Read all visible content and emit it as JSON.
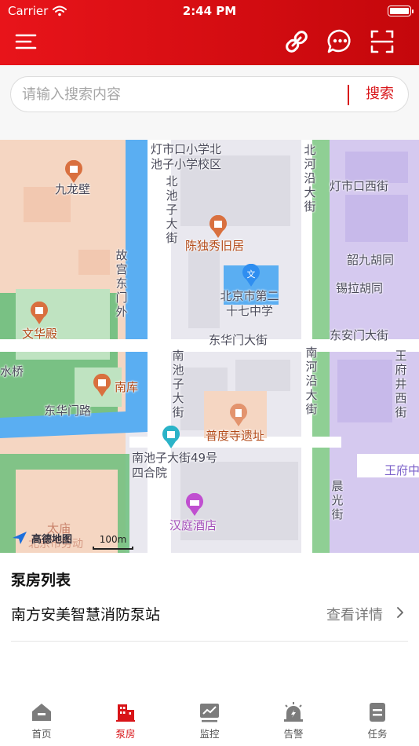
{
  "status_bar": {
    "carrier": "Carrier",
    "time": "2:44 PM"
  },
  "header": {
    "icons": [
      "menu-icon",
      "link-icon",
      "chat-icon",
      "scan-icon"
    ],
    "accent_color": "#d81418"
  },
  "search": {
    "placeholder": "请输入搜索内容",
    "button_label": "搜索"
  },
  "map": {
    "labels": {
      "jiulongbi": "九龙壁",
      "dengshikou_school": "灯市口小学北池子小学校区",
      "beichizi_st": "北池子大街",
      "beiheyan_st": "北河沿大街",
      "dengshikou_w_st": "灯市口西街",
      "chenduxiu": "陈独秀旧居",
      "gugong_dongmenwai": "故宫东门外",
      "shaojiu_hutong": "韶九胡同",
      "xila_hutong": "锡拉胡同",
      "school27": "北京市第二十七中学",
      "wenhuadian": "文华殿",
      "donghuamen_st": "东华门大街",
      "dong_anmen_st": "东安门大街",
      "nanheyan_st": "南河沿大街",
      "wangfujing_w_st": "王府井西街",
      "shuiqiao": "水桥",
      "nanchizi_st": "南池子大街",
      "nanku": "南库",
      "donghuamen_rd": "东华门路",
      "pudusi": "普度寺遗址",
      "siheyuan": "南池子大街49号四合院",
      "wangfu": "王府中",
      "chenguang_st": "晨光街",
      "hanting": "汉庭酒店",
      "taimiao": "太庙",
      "beijing_hint": "北京市劳动",
      "amap_logo": "高德地图",
      "scale": "100m"
    }
  },
  "list": {
    "title": "泵房列表",
    "items": [
      {
        "name": "南方安美智慧消防泵站",
        "action": "查看详情"
      }
    ]
  },
  "tabbar": {
    "active": "泵房",
    "tabs": [
      {
        "label": "首页",
        "icon": "home-icon"
      },
      {
        "label": "泵房",
        "icon": "building-icon"
      },
      {
        "label": "监控",
        "icon": "monitor-icon"
      },
      {
        "label": "告警",
        "icon": "alarm-icon"
      },
      {
        "label": "任务",
        "icon": "task-icon"
      }
    ]
  }
}
